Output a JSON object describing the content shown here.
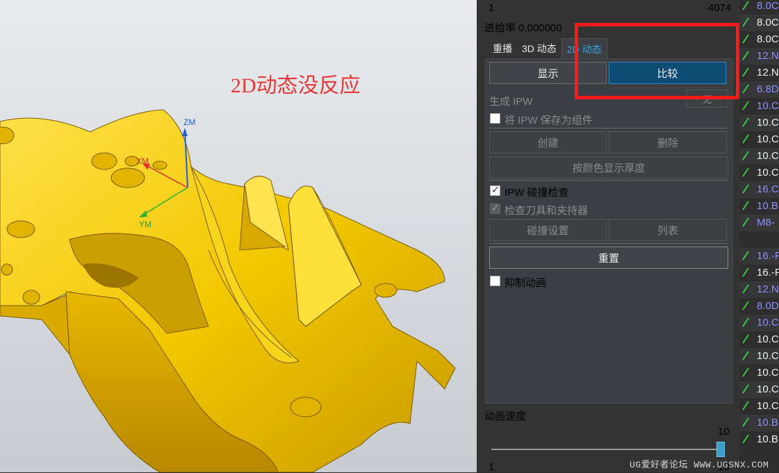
{
  "viewport": {
    "annotation": "2D动态没反应",
    "axes": {
      "zm": "ZM",
      "xm": "XM",
      "ym": "YM"
    }
  },
  "panel": {
    "top_left_value": "1",
    "top_right_value": "4074",
    "feed_rate": "进给率 0.000000",
    "tabs": [
      {
        "label": "重播",
        "active": false
      },
      {
        "label": "3D 动态",
        "active": false
      },
      {
        "label": "2D 动态",
        "active": true
      }
    ],
    "show_button": "显示",
    "compare_button": "比较",
    "generate_ipw_label": "生成 IPW",
    "generate_ipw_dropdown": "无",
    "save_ipw_component": "将 IPW 保存为组件",
    "create_button": "创建",
    "delete_button": "删除",
    "thickness_button": "按颜色显示厚度",
    "collision_check": "IPW 碰撞检查",
    "check_tool_holder": "检查刀具和夹持器",
    "collision_settings_button": "碰撞设置",
    "list_button": "列表",
    "reset_button": "重置",
    "suppress_animation": "抑制动画",
    "animation_speed_label": "动画速度",
    "slider_max": "10",
    "slider_min": "1",
    "slider_right_label": "10",
    "slider_value": 10
  },
  "list": {
    "items": [
      {
        "text": "8.0C",
        "color": "#8f8fff",
        "tick": true
      },
      {
        "text": "8.0C",
        "color": "#f0f0f0",
        "tick": true
      },
      {
        "text": "8.0C",
        "color": "#f0f0f0",
        "tick": true
      },
      {
        "text": "12.N",
        "color": "#8f8fff",
        "tick": true
      },
      {
        "text": "12.N",
        "color": "#f0f0f0",
        "tick": true
      },
      {
        "text": "6.8D",
        "color": "#8f8fff",
        "tick": true
      },
      {
        "text": "10.C",
        "color": "#8f8fff",
        "tick": true
      },
      {
        "text": "10.C",
        "color": "#f0f0f0",
        "tick": true
      },
      {
        "text": "10.C",
        "color": "#f0f0f0",
        "tick": true
      },
      {
        "text": "10.C",
        "color": "#f0f0f0",
        "tick": true
      },
      {
        "text": "10.C",
        "color": "#f0f0f0",
        "tick": true
      },
      {
        "text": "16.C",
        "color": "#8f8fff",
        "tick": true
      },
      {
        "text": "10.B",
        "color": "#8f8fff",
        "tick": true
      },
      {
        "text": "M8-",
        "color": "#8f8fff",
        "tick": true
      },
      {
        "text": "",
        "color": "#f0f0f0",
        "tick": false
      },
      {
        "text": "16.-F",
        "color": "#8f8fff",
        "tick": true
      },
      {
        "text": "16.-F",
        "color": "#f0f0f0",
        "tick": true
      },
      {
        "text": "12.N",
        "color": "#8f8fff",
        "tick": true
      },
      {
        "text": "8.0D",
        "color": "#8f8fff",
        "tick": true
      },
      {
        "text": "10.C",
        "color": "#8f8fff",
        "tick": true
      },
      {
        "text": "10.C",
        "color": "#f0f0f0",
        "tick": true
      },
      {
        "text": "10.C",
        "color": "#f0f0f0",
        "tick": true
      },
      {
        "text": "10.C",
        "color": "#f0f0f0",
        "tick": true
      },
      {
        "text": "10.C",
        "color": "#f0f0f0",
        "tick": true
      },
      {
        "text": "10.C",
        "color": "#f0f0f0",
        "tick": true
      },
      {
        "text": "10.B",
        "color": "#8f8fff",
        "tick": true
      },
      {
        "text": "10.B",
        "color": "#f0f0f0",
        "tick": true
      }
    ]
  },
  "watermark": "UG爱好者论坛 WWW.UGSNX.COM",
  "colors": {
    "highlight_box": "#ff1a1a",
    "active_tab": "#35a6e8",
    "part": "#f5cf00"
  }
}
